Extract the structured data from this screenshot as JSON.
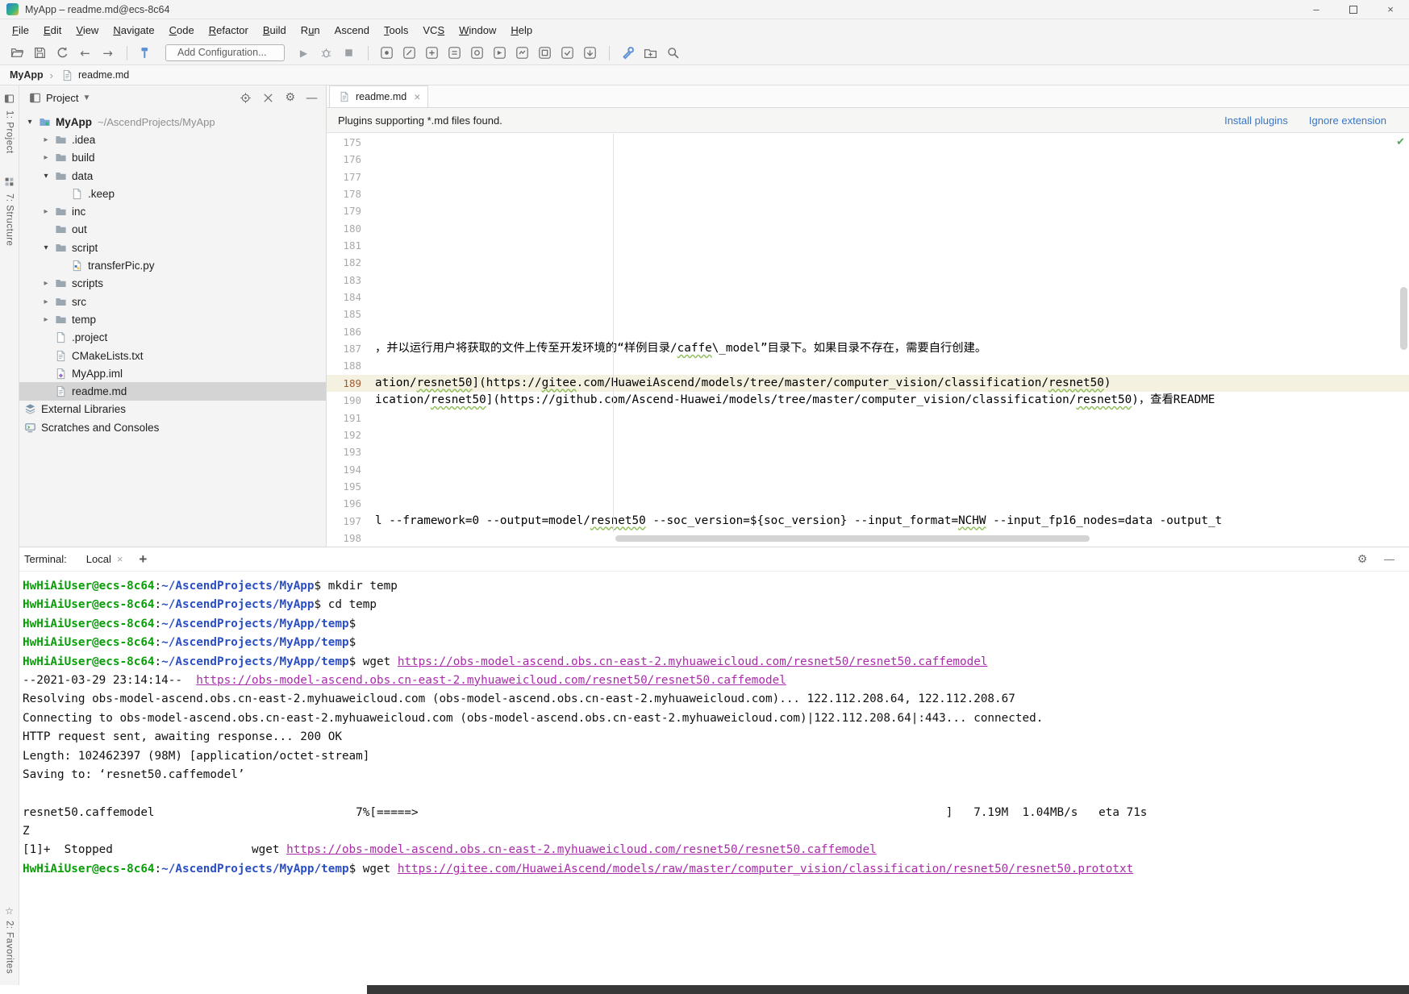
{
  "window": {
    "title": "MyApp – readme.md@ecs-8c64",
    "controls": [
      {
        "name": "minimize-button",
        "glyph": "–"
      },
      {
        "name": "maximize-button",
        "glyph": "box"
      },
      {
        "name": "close-button",
        "glyph": "×"
      }
    ]
  },
  "menu": {
    "items": [
      {
        "label": "File",
        "m": 0
      },
      {
        "label": "Edit",
        "m": 0
      },
      {
        "label": "View",
        "m": 0
      },
      {
        "label": "Navigate",
        "m": 0
      },
      {
        "label": "Code",
        "m": 0
      },
      {
        "label": "Refactor",
        "m": 0
      },
      {
        "label": "Build",
        "m": 0
      },
      {
        "label": "Run",
        "m": 1
      },
      {
        "label": "Ascend",
        "m": -1
      },
      {
        "label": "Tools",
        "m": 0
      },
      {
        "label": "VCS",
        "m": 2
      },
      {
        "label": "Window",
        "m": 0
      },
      {
        "label": "Help",
        "m": 0
      }
    ]
  },
  "toolbar": {
    "items": [
      {
        "type": "icon",
        "name": "open-icon",
        "icon": "open"
      },
      {
        "type": "icon",
        "name": "save-all-icon",
        "icon": "save"
      },
      {
        "type": "icon",
        "name": "synchronize-icon",
        "icon": "sync"
      },
      {
        "type": "icon",
        "name": "back-icon",
        "icon": "back"
      },
      {
        "type": "icon",
        "name": "forward-icon",
        "icon": "fwd"
      },
      {
        "type": "sep"
      },
      {
        "type": "icon",
        "name": "build-project-icon",
        "icon": "hammer"
      },
      {
        "type": "select",
        "name": "run-configurations-select",
        "label": "Add Configuration..."
      },
      {
        "type": "icon",
        "name": "run-icon",
        "icon": "run"
      },
      {
        "type": "icon",
        "name": "debug-icon",
        "icon": "debug"
      },
      {
        "type": "icon",
        "name": "stop-icon",
        "icon": "stop"
      },
      {
        "type": "sep"
      },
      {
        "type": "icon",
        "name": "ascend-tool-icon-1",
        "icon": "sq1"
      },
      {
        "type": "icon",
        "name": "ascend-tool-icon-2",
        "icon": "sq2"
      },
      {
        "type": "icon",
        "name": "ascend-tool-icon-3",
        "icon": "sq3"
      },
      {
        "type": "icon",
        "name": "ascend-tool-icon-4",
        "icon": "sq4"
      },
      {
        "type": "icon",
        "name": "ascend-tool-icon-5",
        "icon": "sq5"
      },
      {
        "type": "icon",
        "name": "ascend-tool-icon-6",
        "icon": "sq6"
      },
      {
        "type": "icon",
        "name": "ascend-tool-icon-7",
        "icon": "sq7"
      },
      {
        "type": "icon",
        "name": "ascend-tool-icon-8",
        "icon": "sq8"
      },
      {
        "type": "icon",
        "name": "ascend-tool-icon-9",
        "icon": "sq9"
      },
      {
        "type": "icon",
        "name": "ascend-tool-icon-10",
        "icon": "sq10"
      },
      {
        "type": "sep"
      },
      {
        "type": "icon",
        "name": "settings-wrench-icon",
        "icon": "wrench"
      },
      {
        "type": "icon",
        "name": "new-directory-icon",
        "icon": "folderplus"
      },
      {
        "type": "icon",
        "name": "search-everywhere-icon",
        "icon": "search"
      }
    ]
  },
  "breadcrumb": {
    "project": "MyApp",
    "file": "readme.md"
  },
  "tool_stripes": {
    "left_top": [
      {
        "name": "project",
        "label": "1: Project",
        "icon": "panelicon"
      },
      {
        "name": "structure",
        "label": "7: Structure",
        "icon": "grid"
      }
    ],
    "left_bottom": [
      {
        "name": "favorites",
        "label": "2: Favorites",
        "icon": "star"
      }
    ]
  },
  "project_panel": {
    "header": "Project",
    "icons": [
      {
        "name": "locate-file-icon",
        "icon": "target"
      },
      {
        "name": "collapse-all-icon",
        "icon": "collapse"
      },
      {
        "name": "panel-settings-icon",
        "icon": "gear"
      },
      {
        "name": "hide-panel-icon",
        "icon": "minus"
      }
    ]
  },
  "project_tree": {
    "items": [
      {
        "label": "MyApp",
        "hint": "~/AscendProjects/MyApp",
        "level": 0,
        "arrow": "down",
        "icon": "projfolder",
        "bold": true
      },
      {
        "label": ".idea",
        "level": 1,
        "arrow": "right",
        "icon": "folder"
      },
      {
        "label": "build",
        "level": 1,
        "arrow": "right",
        "icon": "folder"
      },
      {
        "label": "data",
        "level": 1,
        "arrow": "down",
        "icon": "folder"
      },
      {
        "label": ".keep",
        "level": 2,
        "arrow": null,
        "icon": "file"
      },
      {
        "label": "inc",
        "level": 1,
        "arrow": "right",
        "icon": "folder"
      },
      {
        "label": "out",
        "level": 1,
        "arrow": null,
        "icon": "folder"
      },
      {
        "label": "script",
        "level": 1,
        "arrow": "down",
        "icon": "folder"
      },
      {
        "label": "transferPic.py",
        "level": 2,
        "arrow": null,
        "icon": "file_py"
      },
      {
        "label": "scripts",
        "level": 1,
        "arrow": "right",
        "icon": "folder"
      },
      {
        "label": "src",
        "level": 1,
        "arrow": "right",
        "icon": "folder"
      },
      {
        "label": "temp",
        "level": 1,
        "arrow": "right",
        "icon": "folder"
      },
      {
        "label": ".project",
        "level": 1,
        "arrow": null,
        "icon": "file"
      },
      {
        "label": "CMakeLists.txt",
        "level": 1,
        "arrow": null,
        "icon": "file_lines"
      },
      {
        "label": "MyApp.iml",
        "level": 1,
        "arrow": null,
        "icon": "file_iml"
      },
      {
        "label": "readme.md",
        "level": 1,
        "arrow": null,
        "icon": "file_lines",
        "selected": true
      },
      {
        "label": "External Libraries",
        "level": 0,
        "arrow": null,
        "icon": "lib",
        "compact": true
      },
      {
        "label": "Scratches and Consoles",
        "level": 0,
        "arrow": null,
        "icon": "scratch",
        "compact": true
      }
    ]
  },
  "editor": {
    "tab": "readme.md",
    "notification": {
      "text": "Plugins supporting *.md files found.",
      "actions": [
        "Install plugins",
        "Ignore extension"
      ]
    },
    "lines": [
      {
        "num": 175,
        "segs": []
      },
      {
        "num": 176,
        "segs": []
      },
      {
        "num": 177,
        "segs": []
      },
      {
        "num": 178,
        "segs": []
      },
      {
        "num": 179,
        "segs": []
      },
      {
        "num": 180,
        "segs": []
      },
      {
        "num": 181,
        "segs": []
      },
      {
        "num": 182,
        "segs": []
      },
      {
        "num": 183,
        "segs": []
      },
      {
        "num": 184,
        "segs": []
      },
      {
        "num": 185,
        "segs": []
      },
      {
        "num": 186,
        "segs": []
      },
      {
        "num": 187,
        "segs": [
          {
            "t": "，并以运行用户将获取的文件上传至开发环境的“样例目录/"
          },
          {
            "t": "caffe",
            "cls": "sq"
          },
          {
            "t": "\\_model”目录下。如果目录不存在，需要自行创建。"
          }
        ]
      },
      {
        "num": 188,
        "segs": []
      },
      {
        "num": 189,
        "current": true,
        "segs": [
          {
            "t": "ation/"
          },
          {
            "t": "resnet50",
            "cls": "sq"
          },
          {
            "t": "](https://"
          },
          {
            "t": "gitee",
            "cls": "sq"
          },
          {
            "t": ".com/HuaweiAscend/models/tree/master/computer_vision/classification/"
          },
          {
            "t": "resnet50",
            "cls": "sq"
          },
          {
            "t": ")"
          }
        ]
      },
      {
        "num": 190,
        "segs": [
          {
            "t": "ication/"
          },
          {
            "t": "resnet50",
            "cls": "sq"
          },
          {
            "t": "](https://github.com/Ascend-Huawei/models/tree/master/computer_vision/classification/"
          },
          {
            "t": "resnet50",
            "cls": "sq"
          },
          {
            "t": ")，查看README"
          }
        ]
      },
      {
        "num": 191,
        "segs": []
      },
      {
        "num": 192,
        "segs": []
      },
      {
        "num": 193,
        "segs": []
      },
      {
        "num": 194,
        "segs": []
      },
      {
        "num": 195,
        "segs": []
      },
      {
        "num": 196,
        "segs": []
      },
      {
        "num": 197,
        "segs": [
          {
            "t": "l --framework=0 --output=model/"
          },
          {
            "t": "resnet50",
            "cls": "sq"
          },
          {
            "t": " --soc_version=${soc_version} --input_format="
          },
          {
            "t": "NCHW",
            "cls": "sq"
          },
          {
            "t": " --input_fp16_nodes=data -output_t"
          }
        ]
      },
      {
        "num": 198,
        "segs": []
      }
    ]
  },
  "terminal": {
    "label": "Terminal:",
    "tab": "Local",
    "lines": [
      [
        {
          "t": "HwHiAiUser@ecs-8c64",
          "cls": "t-user"
        },
        {
          "t": ":"
        },
        {
          "t": "~/AscendProjects/MyApp",
          "cls": "t-path"
        },
        {
          "t": "$ mkdir temp"
        }
      ],
      [
        {
          "t": "HwHiAiUser@ecs-8c64",
          "cls": "t-user"
        },
        {
          "t": ":"
        },
        {
          "t": "~/AscendProjects/MyApp",
          "cls": "t-path"
        },
        {
          "t": "$ cd temp"
        }
      ],
      [
        {
          "t": "HwHiAiUser@ecs-8c64",
          "cls": "t-user"
        },
        {
          "t": ":"
        },
        {
          "t": "~/AscendProjects/MyApp/temp",
          "cls": "t-path"
        },
        {
          "t": "$"
        }
      ],
      [
        {
          "t": "HwHiAiUser@ecs-8c64",
          "cls": "t-user"
        },
        {
          "t": ":"
        },
        {
          "t": "~/AscendProjects/MyApp/temp",
          "cls": "t-path"
        },
        {
          "t": "$"
        }
      ],
      [
        {
          "t": "HwHiAiUser@ecs-8c64",
          "cls": "t-user"
        },
        {
          "t": ":"
        },
        {
          "t": "~/AscendProjects/MyApp/temp",
          "cls": "t-path"
        },
        {
          "t": "$ wget "
        },
        {
          "t": "https://obs-model-ascend.obs.cn-east-2.myhuaweicloud.com/resnet50/resnet50.caffemodel",
          "cls": "t-link"
        }
      ],
      [
        {
          "t": "--2021-03-29 23:14:14--  "
        },
        {
          "t": "https://obs-model-ascend.obs.cn-east-2.myhuaweicloud.com/resnet50/resnet50.caffemodel",
          "cls": "t-link"
        }
      ],
      [
        {
          "t": "Resolving obs-model-ascend.obs.cn-east-2.myhuaweicloud.com (obs-model-ascend.obs.cn-east-2.myhuaweicloud.com)... 122.112.208.64, 122.112.208.67"
        }
      ],
      [
        {
          "t": "Connecting to obs-model-ascend.obs.cn-east-2.myhuaweicloud.com (obs-model-ascend.obs.cn-east-2.myhuaweicloud.com)|122.112.208.64|:443... connected."
        }
      ],
      [
        {
          "t": "HTTP request sent, awaiting response... 200 OK"
        }
      ],
      [
        {
          "t": "Length: 102462397 (98M) [application/octet-stream]"
        }
      ],
      [
        {
          "t": "Saving to: ‘resnet50.caffemodel’"
        }
      ],
      [],
      [
        {
          "t": "resnet50.caffemodel                             7%[=====>                                                                            ]   7.19M  1.04MB/s   eta 71s"
        }
      ],
      [
        {
          "t": "Z"
        }
      ],
      [
        {
          "t": "[1]+  Stopped                    wget "
        },
        {
          "t": "https://obs-model-ascend.obs.cn-east-2.myhuaweicloud.com/resnet50/resnet50.caffemodel",
          "cls": "t-link"
        }
      ],
      [
        {
          "t": "HwHiAiUser@ecs-8c64",
          "cls": "t-user"
        },
        {
          "t": ":"
        },
        {
          "t": "~/AscendProjects/MyApp/temp",
          "cls": "t-path"
        },
        {
          "t": "$ wget "
        },
        {
          "t": "https://gitee.com/HuaweiAscend/models/raw/master/computer_vision/classification/resnet50/resnet50.prototxt",
          "cls": "t-link"
        }
      ]
    ]
  },
  "colors": {
    "prompt_user": "#089e08",
    "prompt_path": "#2b4fc2",
    "terminal_link": "#aa2baa",
    "notification_link": "#3876c7",
    "tree_selection": "#d4d4d4",
    "current_line": "#f4f1e0"
  }
}
